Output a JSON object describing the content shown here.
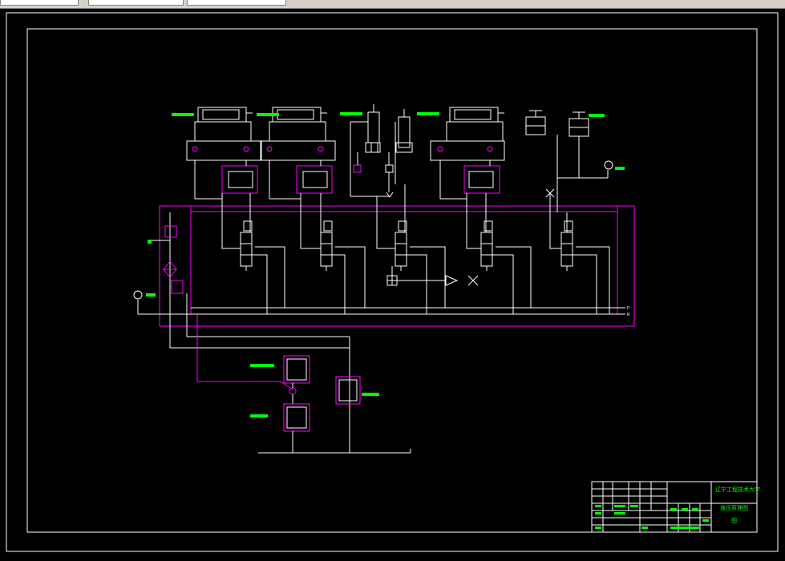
{
  "window": {
    "tabs": [
      "",
      "",
      ""
    ]
  },
  "drawing": {
    "line_color": "#ffffff",
    "circuit_color": "#ff00ff",
    "label_color": "#00ff00",
    "cyl_labels": [
      "",
      "",
      "",
      ""
    ],
    "gauge_labels": [
      "",
      ""
    ],
    "filter_labels": [
      "",
      "",
      ""
    ],
    "port_labels": [
      "P",
      "R"
    ]
  },
  "title_block": {
    "school": "辽宁工程技术大学",
    "drawing_title": "液压原理图",
    "sheet": "图",
    "cells": [
      "",
      "",
      "",
      "",
      "",
      "",
      "",
      "",
      "",
      "",
      "",
      ""
    ]
  }
}
